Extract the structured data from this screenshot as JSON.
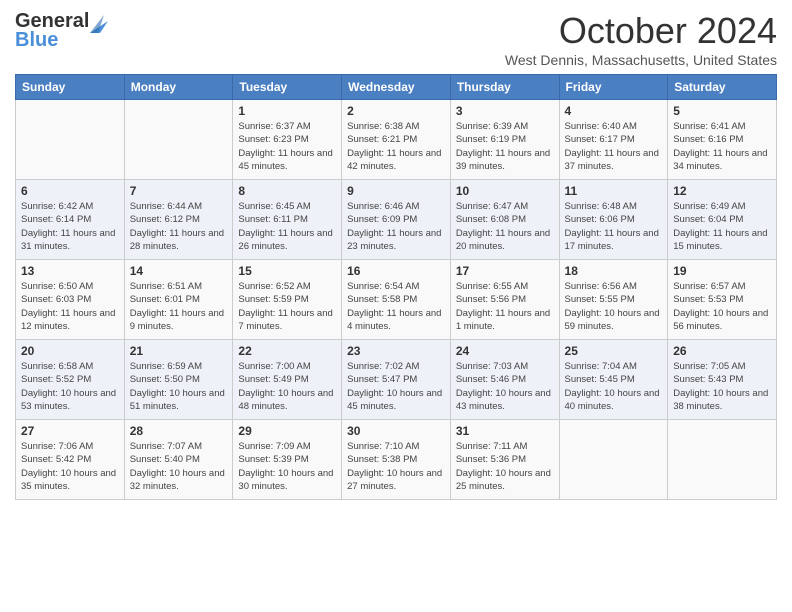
{
  "header": {
    "logo": {
      "general": "General",
      "blue": "Blue"
    },
    "title": "October 2024",
    "location": "West Dennis, Massachusetts, United States"
  },
  "days_of_week": [
    "Sunday",
    "Monday",
    "Tuesday",
    "Wednesday",
    "Thursday",
    "Friday",
    "Saturday"
  ],
  "weeks": [
    [
      {
        "day": null
      },
      {
        "day": null
      },
      {
        "day": "1",
        "sunrise": "Sunrise: 6:37 AM",
        "sunset": "Sunset: 6:23 PM",
        "daylight": "Daylight: 11 hours and 45 minutes."
      },
      {
        "day": "2",
        "sunrise": "Sunrise: 6:38 AM",
        "sunset": "Sunset: 6:21 PM",
        "daylight": "Daylight: 11 hours and 42 minutes."
      },
      {
        "day": "3",
        "sunrise": "Sunrise: 6:39 AM",
        "sunset": "Sunset: 6:19 PM",
        "daylight": "Daylight: 11 hours and 39 minutes."
      },
      {
        "day": "4",
        "sunrise": "Sunrise: 6:40 AM",
        "sunset": "Sunset: 6:17 PM",
        "daylight": "Daylight: 11 hours and 37 minutes."
      },
      {
        "day": "5",
        "sunrise": "Sunrise: 6:41 AM",
        "sunset": "Sunset: 6:16 PM",
        "daylight": "Daylight: 11 hours and 34 minutes."
      }
    ],
    [
      {
        "day": "6",
        "sunrise": "Sunrise: 6:42 AM",
        "sunset": "Sunset: 6:14 PM",
        "daylight": "Daylight: 11 hours and 31 minutes."
      },
      {
        "day": "7",
        "sunrise": "Sunrise: 6:44 AM",
        "sunset": "Sunset: 6:12 PM",
        "daylight": "Daylight: 11 hours and 28 minutes."
      },
      {
        "day": "8",
        "sunrise": "Sunrise: 6:45 AM",
        "sunset": "Sunset: 6:11 PM",
        "daylight": "Daylight: 11 hours and 26 minutes."
      },
      {
        "day": "9",
        "sunrise": "Sunrise: 6:46 AM",
        "sunset": "Sunset: 6:09 PM",
        "daylight": "Daylight: 11 hours and 23 minutes."
      },
      {
        "day": "10",
        "sunrise": "Sunrise: 6:47 AM",
        "sunset": "Sunset: 6:08 PM",
        "daylight": "Daylight: 11 hours and 20 minutes."
      },
      {
        "day": "11",
        "sunrise": "Sunrise: 6:48 AM",
        "sunset": "Sunset: 6:06 PM",
        "daylight": "Daylight: 11 hours and 17 minutes."
      },
      {
        "day": "12",
        "sunrise": "Sunrise: 6:49 AM",
        "sunset": "Sunset: 6:04 PM",
        "daylight": "Daylight: 11 hours and 15 minutes."
      }
    ],
    [
      {
        "day": "13",
        "sunrise": "Sunrise: 6:50 AM",
        "sunset": "Sunset: 6:03 PM",
        "daylight": "Daylight: 11 hours and 12 minutes."
      },
      {
        "day": "14",
        "sunrise": "Sunrise: 6:51 AM",
        "sunset": "Sunset: 6:01 PM",
        "daylight": "Daylight: 11 hours and 9 minutes."
      },
      {
        "day": "15",
        "sunrise": "Sunrise: 6:52 AM",
        "sunset": "Sunset: 5:59 PM",
        "daylight": "Daylight: 11 hours and 7 minutes."
      },
      {
        "day": "16",
        "sunrise": "Sunrise: 6:54 AM",
        "sunset": "Sunset: 5:58 PM",
        "daylight": "Daylight: 11 hours and 4 minutes."
      },
      {
        "day": "17",
        "sunrise": "Sunrise: 6:55 AM",
        "sunset": "Sunset: 5:56 PM",
        "daylight": "Daylight: 11 hours and 1 minute."
      },
      {
        "day": "18",
        "sunrise": "Sunrise: 6:56 AM",
        "sunset": "Sunset: 5:55 PM",
        "daylight": "Daylight: 10 hours and 59 minutes."
      },
      {
        "day": "19",
        "sunrise": "Sunrise: 6:57 AM",
        "sunset": "Sunset: 5:53 PM",
        "daylight": "Daylight: 10 hours and 56 minutes."
      }
    ],
    [
      {
        "day": "20",
        "sunrise": "Sunrise: 6:58 AM",
        "sunset": "Sunset: 5:52 PM",
        "daylight": "Daylight: 10 hours and 53 minutes."
      },
      {
        "day": "21",
        "sunrise": "Sunrise: 6:59 AM",
        "sunset": "Sunset: 5:50 PM",
        "daylight": "Daylight: 10 hours and 51 minutes."
      },
      {
        "day": "22",
        "sunrise": "Sunrise: 7:00 AM",
        "sunset": "Sunset: 5:49 PM",
        "daylight": "Daylight: 10 hours and 48 minutes."
      },
      {
        "day": "23",
        "sunrise": "Sunrise: 7:02 AM",
        "sunset": "Sunset: 5:47 PM",
        "daylight": "Daylight: 10 hours and 45 minutes."
      },
      {
        "day": "24",
        "sunrise": "Sunrise: 7:03 AM",
        "sunset": "Sunset: 5:46 PM",
        "daylight": "Daylight: 10 hours and 43 minutes."
      },
      {
        "day": "25",
        "sunrise": "Sunrise: 7:04 AM",
        "sunset": "Sunset: 5:45 PM",
        "daylight": "Daylight: 10 hours and 40 minutes."
      },
      {
        "day": "26",
        "sunrise": "Sunrise: 7:05 AM",
        "sunset": "Sunset: 5:43 PM",
        "daylight": "Daylight: 10 hours and 38 minutes."
      }
    ],
    [
      {
        "day": "27",
        "sunrise": "Sunrise: 7:06 AM",
        "sunset": "Sunset: 5:42 PM",
        "daylight": "Daylight: 10 hours and 35 minutes."
      },
      {
        "day": "28",
        "sunrise": "Sunrise: 7:07 AM",
        "sunset": "Sunset: 5:40 PM",
        "daylight": "Daylight: 10 hours and 32 minutes."
      },
      {
        "day": "29",
        "sunrise": "Sunrise: 7:09 AM",
        "sunset": "Sunset: 5:39 PM",
        "daylight": "Daylight: 10 hours and 30 minutes."
      },
      {
        "day": "30",
        "sunrise": "Sunrise: 7:10 AM",
        "sunset": "Sunset: 5:38 PM",
        "daylight": "Daylight: 10 hours and 27 minutes."
      },
      {
        "day": "31",
        "sunrise": "Sunrise: 7:11 AM",
        "sunset": "Sunset: 5:36 PM",
        "daylight": "Daylight: 10 hours and 25 minutes."
      },
      {
        "day": null
      },
      {
        "day": null
      }
    ]
  ]
}
